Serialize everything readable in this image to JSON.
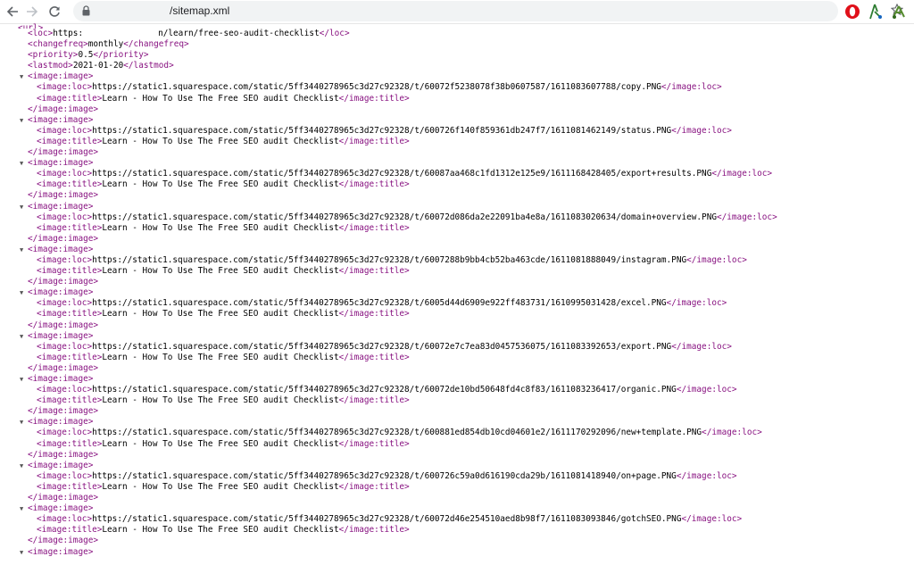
{
  "browser": {
    "url_host_hidden": "",
    "url_path": "/sitemap.xml",
    "icons": [
      "back-arrow-icon",
      "forward-arrow-icon",
      "reload-icon",
      "lock-icon",
      "star-icon",
      "opera-icon",
      "extension-icon",
      "puzzle-icon"
    ]
  },
  "xml": {
    "first_partial": "<url>",
    "loc_prefix": "https:",
    "loc_suffix": "n/learn/free-seo-audit-checklist",
    "changefreq": "monthly",
    "priority": "0.5",
    "lastmod": "2021-01-20",
    "image_title": "Learn - How To Use The Free SEO audit Checklist",
    "images": [
      "https://static1.squarespace.com/static/5ff3440278965c3d27c92328/t/60072f5238078f38b0607587/1611083607788/copy.PNG",
      "https://static1.squarespace.com/static/5ff3440278965c3d27c92328/t/600726f140f859361db247f7/1611081462149/status.PNG",
      "https://static1.squarespace.com/static/5ff3440278965c3d27c92328/t/60087aa468c1fd1312e125e9/1611168428405/export+results.PNG",
      "https://static1.squarespace.com/static/5ff3440278965c3d27c92328/t/60072d086da2e22091ba4e8a/1611083020634/domain+overview.PNG",
      "https://static1.squarespace.com/static/5ff3440278965c3d27c92328/t/6007288b9bb4cb52ba463cde/1611081888049/instagram.PNG",
      "https://static1.squarespace.com/static/5ff3440278965c3d27c92328/t/6005d44d6909e922ff483731/1610995031428/excel.PNG",
      "https://static1.squarespace.com/static/5ff3440278965c3d27c92328/t/60072e7c7ea83d0457536075/1611083392653/export.PNG",
      "https://static1.squarespace.com/static/5ff3440278965c3d27c92328/t/60072de10bd50648fd4c8f83/1611083236417/organic.PNG",
      "https://static1.squarespace.com/static/5ff3440278965c3d27c92328/t/600881ed854db10cd04601e2/1611170292096/new+template.PNG",
      "https://static1.squarespace.com/static/5ff3440278965c3d27c92328/t/600726c59a0d616190cda29b/1611081418940/on+page.PNG",
      "https://static1.squarespace.com/static/5ff3440278965c3d27c92328/t/60072d46e254510aed8b98f7/1611083093846/gotchSEO.PNG"
    ],
    "last_partial": "<image:image>"
  },
  "colors": {
    "tag": "#881280",
    "text": "#000000",
    "omnibox": "#f1f3f4"
  }
}
